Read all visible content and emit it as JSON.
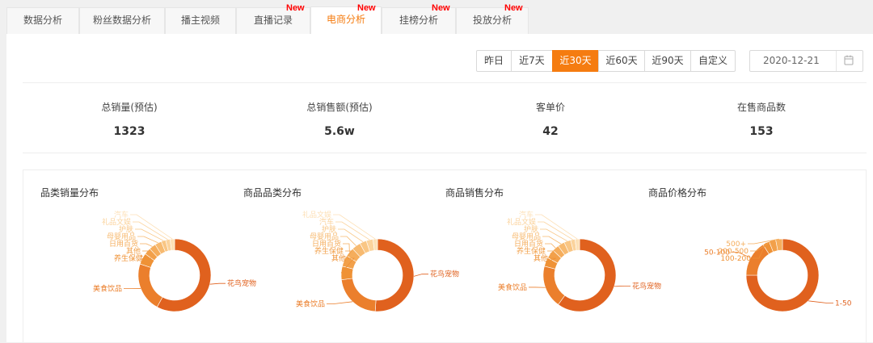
{
  "tabs": [
    {
      "label": "数据分析",
      "new": false,
      "active": false
    },
    {
      "label": "粉丝数据分析",
      "new": false,
      "active": false
    },
    {
      "label": "播主视频",
      "new": false,
      "active": false
    },
    {
      "label": "直播记录",
      "new": true,
      "active": false
    },
    {
      "label": "电商分析",
      "new": true,
      "active": true
    },
    {
      "label": "挂榜分析",
      "new": true,
      "active": false
    },
    {
      "label": "投放分析",
      "new": true,
      "active": false
    }
  ],
  "new_badge": "New",
  "range": {
    "options": [
      "昨日",
      "近7天",
      "近30天",
      "近60天",
      "近90天",
      "自定义"
    ],
    "selected": "近30天"
  },
  "date": {
    "value": "2020-12-21",
    "icon": "calendar-icon"
  },
  "stats": [
    {
      "label": "总销量(预估)",
      "value": "1323"
    },
    {
      "label": "总销售额(预估)",
      "value": "5.6w"
    },
    {
      "label": "客单价",
      "value": "42"
    },
    {
      "label": "在售商品数",
      "value": "153"
    }
  ],
  "colors": {
    "accent": "#f57c10",
    "new": "#ff0000"
  },
  "chart_data": [
    {
      "type": "pie",
      "title": "品类销量分布",
      "labels": [
        "花鸟宠物",
        "美食饮品",
        "养生保健",
        "其他",
        "日用百货",
        "母婴用品",
        "护肤",
        "礼品文娱",
        "汽车"
      ],
      "values": [
        58,
        22,
        5,
        3,
        3,
        3,
        2,
        2,
        2
      ]
    },
    {
      "type": "pie",
      "title": "商品品类分布",
      "labels": [
        "花鸟宠物",
        "美食饮品",
        "其他",
        "养生保健",
        "日用百货",
        "母婴用品",
        "护肤",
        "汽车",
        "礼品文娱"
      ],
      "values": [
        51,
        22,
        6,
        5,
        4,
        4,
        3,
        3,
        2
      ]
    },
    {
      "type": "pie",
      "title": "商品销售分布",
      "labels": [
        "花鸟宠物",
        "美食饮品",
        "其他",
        "养生保健",
        "日用百货",
        "母婴用品",
        "护肤",
        "礼品文娱",
        "汽车"
      ],
      "values": [
        60,
        19,
        4,
        4,
        3,
        3,
        3,
        2,
        2
      ]
    },
    {
      "type": "pie",
      "title": "商品价格分布",
      "labels": [
        "1-50",
        "50-100",
        "100-200",
        "200-500",
        "500+"
      ],
      "values": [
        75,
        16,
        3,
        3,
        3
      ]
    }
  ]
}
